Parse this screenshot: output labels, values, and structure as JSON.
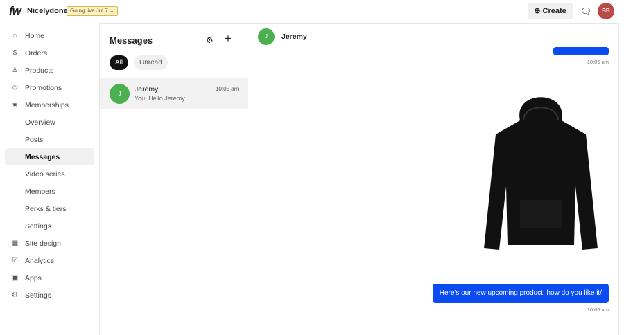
{
  "header": {
    "logo": "fw",
    "brand": "Nicelydone",
    "badge": "Going live Jul 7 ⌄",
    "create": "Create",
    "avatar": "BB"
  },
  "sidebar": [
    {
      "label": "Home",
      "icon": "⌂"
    },
    {
      "label": "Orders",
      "icon": "$"
    },
    {
      "label": "Products",
      "icon": "♙"
    },
    {
      "label": "Promotions",
      "icon": "◇"
    },
    {
      "label": "Memberships",
      "icon": "★"
    },
    {
      "label": "Overview"
    },
    {
      "label": "Posts"
    },
    {
      "label": "Messages"
    },
    {
      "label": "Video series"
    },
    {
      "label": "Members"
    },
    {
      "label": "Perks & tiers"
    },
    {
      "label": "Settings"
    },
    {
      "label": "Site design",
      "icon": "▦"
    },
    {
      "label": "Analytics",
      "icon": "☑"
    },
    {
      "label": "Apps",
      "icon": "▣"
    },
    {
      "label": "Settings",
      "icon": "⚙"
    }
  ],
  "messages": {
    "title": "Messages",
    "filters": [
      "All",
      "Unread"
    ],
    "conversation": {
      "initial": "J",
      "name": "Jeremy",
      "time": "10:05 am",
      "preview": "You: Hello Jeremy"
    }
  },
  "chat": {
    "initial": "J",
    "name": "Jeremy",
    "t1": "10:05 am",
    "text": "Here's our new upcoming product. how do you like it/",
    "t2": "10:06 am"
  }
}
